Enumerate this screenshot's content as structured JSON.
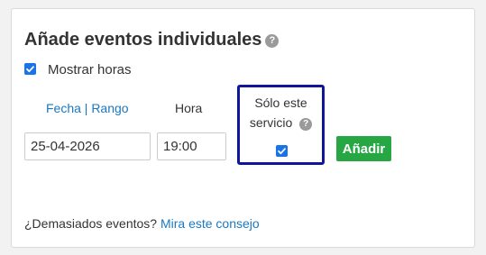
{
  "panel": {
    "title": "Añade eventos individuales",
    "title_help_icon": "?"
  },
  "show_hours": {
    "label": "Mostrar horas",
    "checked": true
  },
  "date_column": {
    "label": "Fecha | Rango",
    "value": "25-04-2026"
  },
  "hour_column": {
    "label": "Hora",
    "value": "19:00"
  },
  "only_service": {
    "label_line1": "Sólo este",
    "label_line2": "servicio",
    "help_icon": "?",
    "checked": true
  },
  "add_button": {
    "label": "Añadir"
  },
  "footer": {
    "text": "¿Demasiados eventos?",
    "link": "Mira este consejo"
  },
  "colors": {
    "accent_blue": "#1a73e8",
    "link": "#1a78c2",
    "button_green": "#27a644",
    "highlight_border": "#10169a"
  }
}
